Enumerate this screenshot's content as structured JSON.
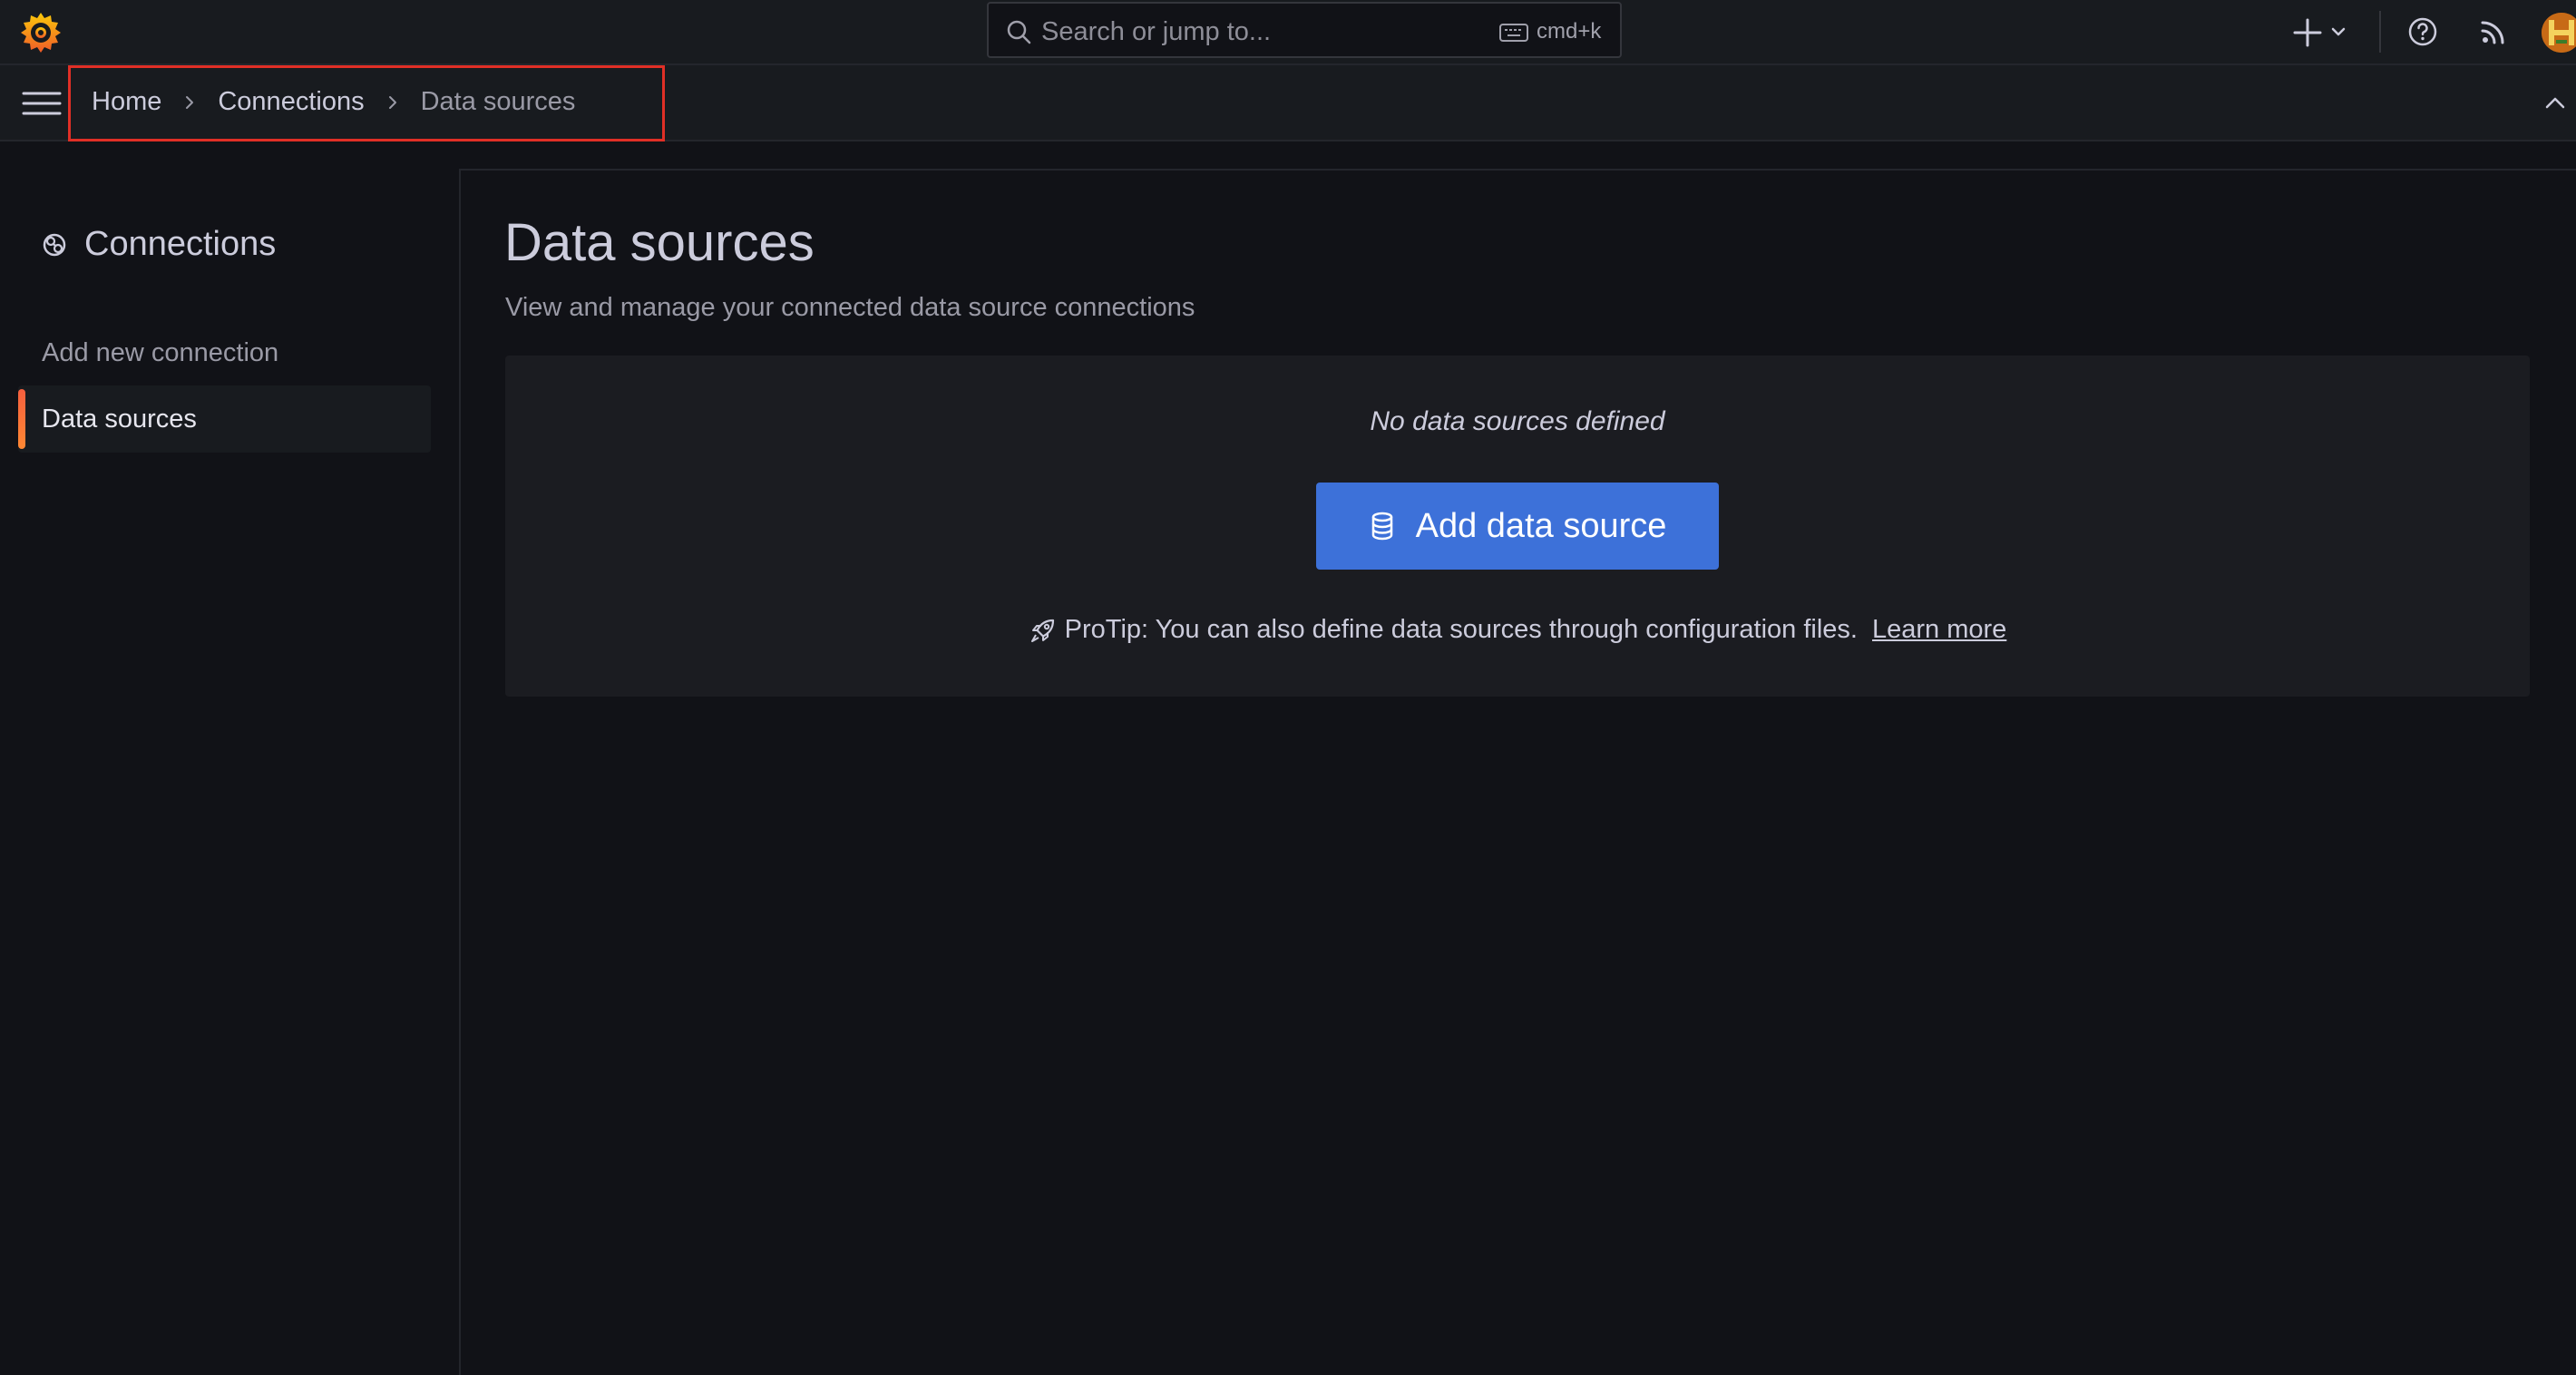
{
  "app": {
    "logo_icon": "grafana-logo-icon",
    "accent_color": "#f55f3e",
    "primary_button_color": "#3d71d9",
    "highlight_box_color": "#e02f26"
  },
  "topbar": {
    "search": {
      "placeholder": "Search or jump to...",
      "shortcut": "cmd+k",
      "icon": "search-icon",
      "shortcut_icon": "keyboard-icon"
    },
    "new_menu_icon": "plus-icon",
    "help_icon": "help-icon",
    "news_icon": "rss-icon",
    "avatar_icon": "user-avatar"
  },
  "breadcrumbs": {
    "items": [
      "Home",
      "Connections",
      "Data sources"
    ],
    "separator_icon": "chevron-right-icon"
  },
  "sidebar": {
    "title": "Connections",
    "title_icon": "connections-icon",
    "items": [
      {
        "label": "Add new connection",
        "active": false
      },
      {
        "label": "Data sources",
        "active": true
      }
    ]
  },
  "main": {
    "title": "Data sources",
    "subtitle": "View and manage your connected data source connections",
    "empty_state": {
      "message": "No data sources defined",
      "button_label": "Add data source",
      "button_icon": "database-icon",
      "protip_icon": "rocket-icon",
      "protip_text": "ProTip: You can also define data sources through configuration files.",
      "protip_link": "Learn more"
    }
  }
}
